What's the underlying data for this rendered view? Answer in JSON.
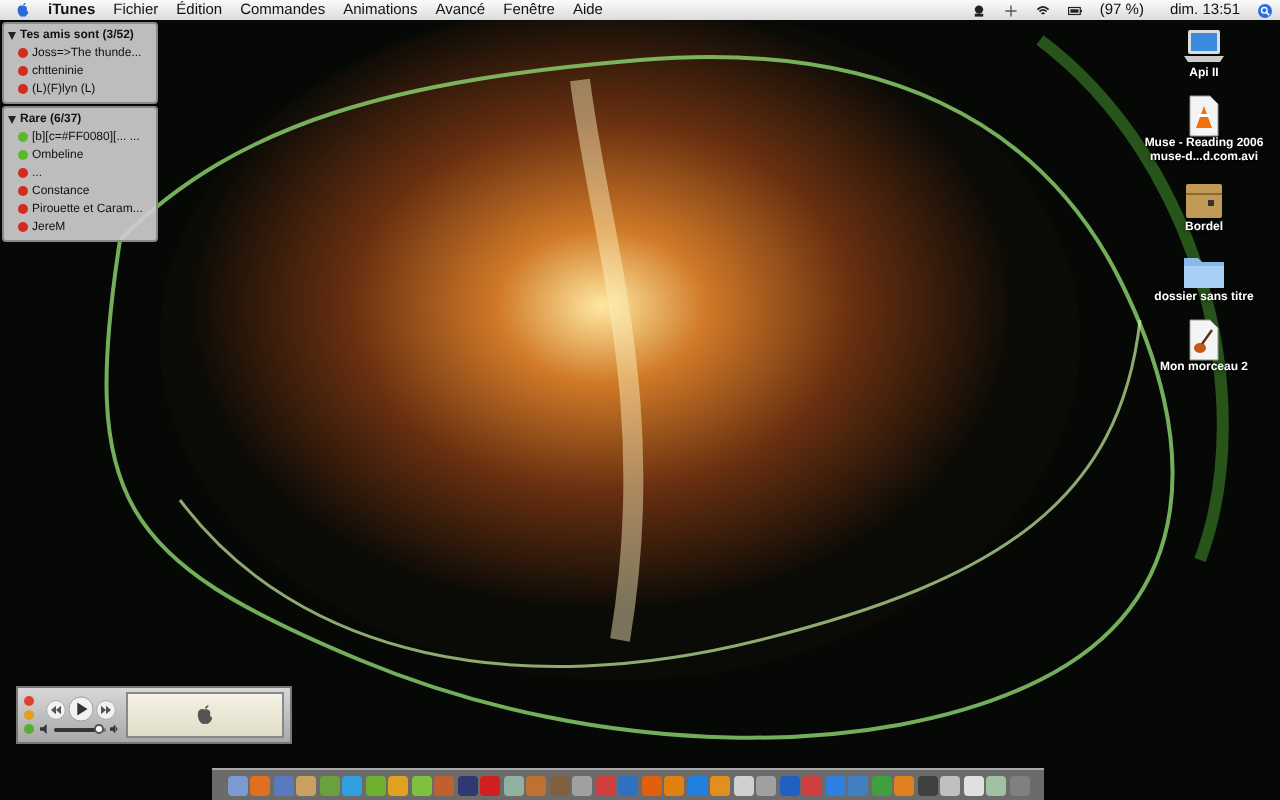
{
  "menu_bar": {
    "app_name": "iTunes",
    "menus": [
      "Fichier",
      "Édition",
      "Commandes",
      "Animations",
      "Avancé",
      "Fenêtre",
      "Aide"
    ],
    "battery": "(97 %)",
    "clock": "dim. 13:51"
  },
  "buddy_list": {
    "groups": [
      {
        "name": "Tes amis sont (3/52)",
        "expanded": true,
        "buddies": [
          {
            "name": "Joss=>The thunde...",
            "color": "#d42a20"
          },
          {
            "name": "chtteninie",
            "color": "#d42a20"
          },
          {
            "name": "(L)(F)lyn  (L)",
            "color": "#d42a20"
          }
        ]
      },
      {
        "name": "Rare (6/37)",
        "expanded": true,
        "buddies": [
          {
            "name": "[b][c=#FF0080][... ...",
            "color": "#5cb82a"
          },
          {
            "name": "Ombeline",
            "color": "#5cb82a"
          },
          {
            "name": "...",
            "color": "#d42a20"
          },
          {
            "name": "Constance",
            "color": "#d42a20"
          },
          {
            "name": "Pirouette et Caram...",
            "color": "#d42a20"
          },
          {
            "name": "JereM",
            "color": "#d42a20"
          }
        ]
      }
    ]
  },
  "desktop_icons": [
    {
      "kind": "laptop",
      "label": "Api II"
    },
    {
      "kind": "video",
      "label": "Muse - Reading 2006 muse-d...d.com.avi"
    },
    {
      "kind": "box",
      "label": "Bordel"
    },
    {
      "kind": "folder",
      "label": "dossier sans titre"
    },
    {
      "kind": "music",
      "label": "Mon morceau 2"
    }
  ],
  "mini_player": {
    "volume": {
      "level": 0.85
    }
  }
}
